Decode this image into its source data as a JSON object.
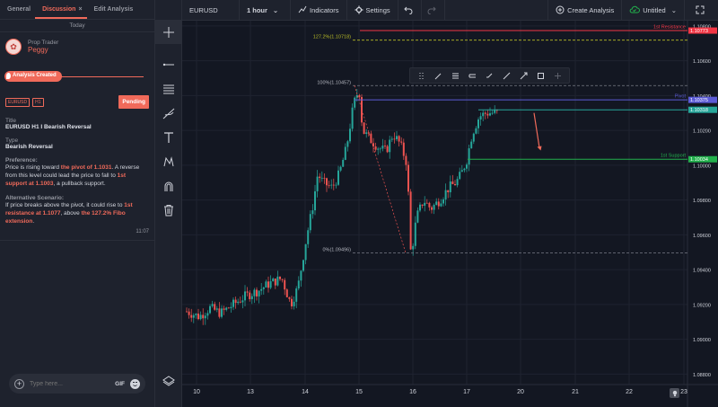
{
  "tabs": [
    {
      "label": "General"
    },
    {
      "label": "Discussion",
      "close": "×"
    },
    {
      "label": "Edit Analysis"
    }
  ],
  "date_separator": "Today",
  "author": {
    "role": "Prop Trader",
    "name": "Peggy"
  },
  "analysis_created": "Analysis Created",
  "badges": [
    "EURUSD",
    "H1"
  ],
  "status": "Pending",
  "fields": {
    "title_label": "Title",
    "title_value": "EURUSD H1 I Bearish Reversal",
    "type_label": "Type",
    "type_value": "Bearish Reversal",
    "preference_label": "Preference:",
    "preference": {
      "t1": "Price is rising toward ",
      "h1": "the pivot of 1.1031",
      "t2": ". A reverse from this level could lead the price to fall to ",
      "h2": "1st support at 1.1003",
      "t3": ", a pullback support."
    },
    "alt_label": "Alternative Scenario:",
    "alt": {
      "t1": "If price breaks above the pivot, it could rise to ",
      "h1": "1st resistance at 1.1077",
      "t2": ", above ",
      "h2": "the 127.2% Fibo extension",
      "t3": "."
    }
  },
  "message_time": "11:07",
  "input": {
    "placeholder": "Type here...",
    "gif_label": "GIF"
  },
  "topbar": {
    "symbol": "EURUSD",
    "timeframe": "1 hour",
    "indicators": "Indicators",
    "settings": "Settings",
    "create_analysis": "Create Analysis",
    "untitled": "Untitled"
  },
  "colors": {
    "accent": "#f06a5a",
    "up": "#26a69a",
    "down": "#ef5350",
    "resistance": "#f23645",
    "pivot": "#5b5bd6",
    "support": "#22b04c",
    "fib": "#b8bb26"
  },
  "chart_data": {
    "type": "candlestick",
    "ylim": [
      1.0874,
      1.1083
    ],
    "y_ticks": [
      "1.10800",
      "1.10600",
      "1.10400",
      "1.10200",
      "1.10000",
      "1.09800",
      "1.09600",
      "1.09400",
      "1.09200",
      "1.09000",
      "1.08800"
    ],
    "x_ticks": [
      "10",
      "13",
      "14",
      "15",
      "16",
      "17",
      "20",
      "21",
      "22",
      "23"
    ],
    "levels": [
      {
        "label": "1st Resistance",
        "price": "1.10773",
        "value": 1.10773,
        "color": "resistance"
      },
      {
        "label": "Pivot",
        "price": "1.10375",
        "value": 1.10375,
        "color": "pivot"
      },
      {
        "label": "",
        "price": "1.10318",
        "value": 1.10318,
        "color": "up"
      },
      {
        "label": "1st Support",
        "price": "1.10034",
        "value": 1.10034,
        "color": "support"
      }
    ],
    "fib_levels": [
      {
        "label": "127.2%(1.10718)",
        "value": 1.10718
      },
      {
        "label": "100%(1.10457)",
        "value": 1.10457
      },
      {
        "label": "0%(1.09496)",
        "value": 1.09496
      }
    ]
  }
}
